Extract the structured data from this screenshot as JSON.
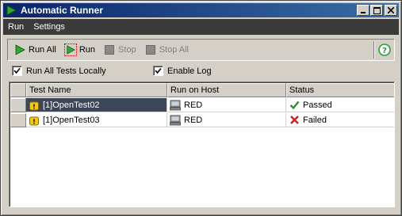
{
  "window": {
    "title": "Automatic Runner"
  },
  "menu": {
    "items": [
      "Run",
      "Settings"
    ]
  },
  "toolbar": {
    "run_all": "Run All",
    "run": "Run",
    "stop": "Stop",
    "stop_all": "Stop All"
  },
  "options": {
    "run_locally": {
      "label": "Run All Tests Locally",
      "checked": true
    },
    "enable_log": {
      "label": "Enable Log",
      "checked": true
    }
  },
  "table": {
    "columns": [
      "Test Name",
      "Run on Host",
      "Status"
    ],
    "rows": [
      {
        "name": "[1]OpenTest02",
        "host": "RED",
        "status": "Passed",
        "status_icon": "check-icon",
        "selected": true
      },
      {
        "name": "[1]OpenTest03",
        "host": "RED",
        "status": "Failed",
        "status_icon": "x-icon",
        "selected": false
      }
    ]
  },
  "colors": {
    "title_start": "#0a246a",
    "title_end": "#3a6ea5",
    "menubar": "#3a3a3a",
    "selection": "#3c4657",
    "passed": "#2e8b2e",
    "failed": "#cc2222"
  }
}
